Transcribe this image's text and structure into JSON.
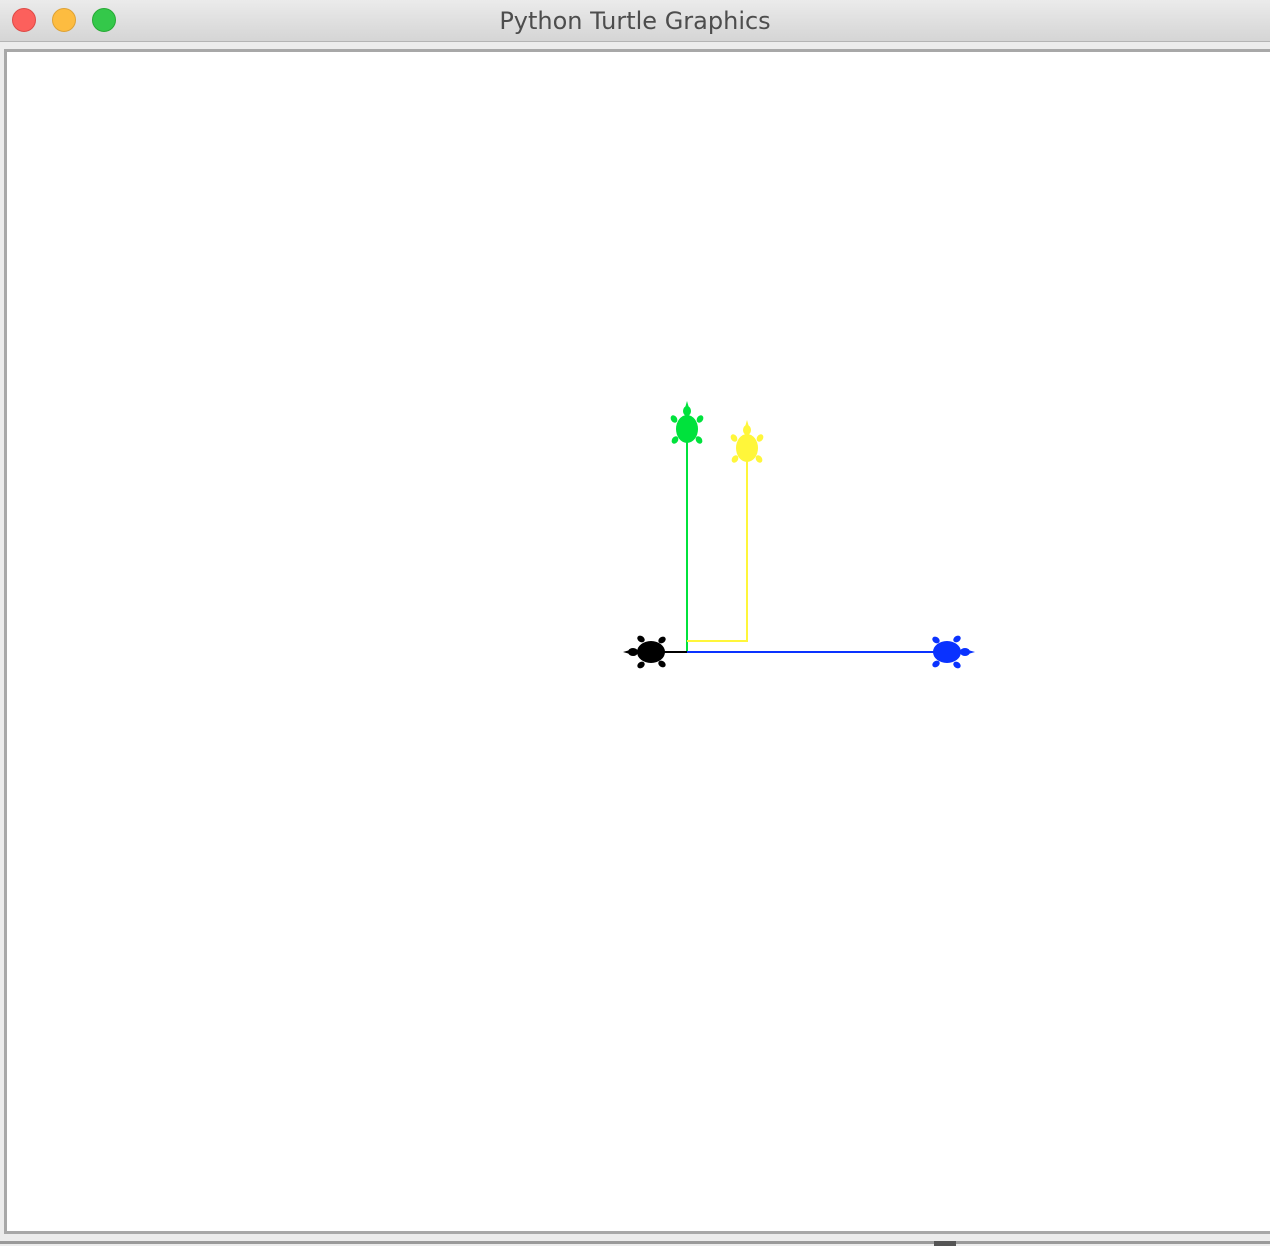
{
  "window": {
    "title": "Python Turtle Graphics"
  },
  "colors": {
    "green": "#00e23c",
    "yellow": "#fff63a",
    "blue": "#0a32ff",
    "black": "#000000",
    "canvas_background": "#ffffff"
  },
  "turtles": [
    {
      "name": "black",
      "color": "#000000",
      "heading": "left"
    },
    {
      "name": "green",
      "color": "#00e23c",
      "heading": "up"
    },
    {
      "name": "yellow",
      "color": "#fff63a",
      "heading": "up"
    },
    {
      "name": "blue",
      "color": "#0a32ff",
      "heading": "right"
    }
  ]
}
